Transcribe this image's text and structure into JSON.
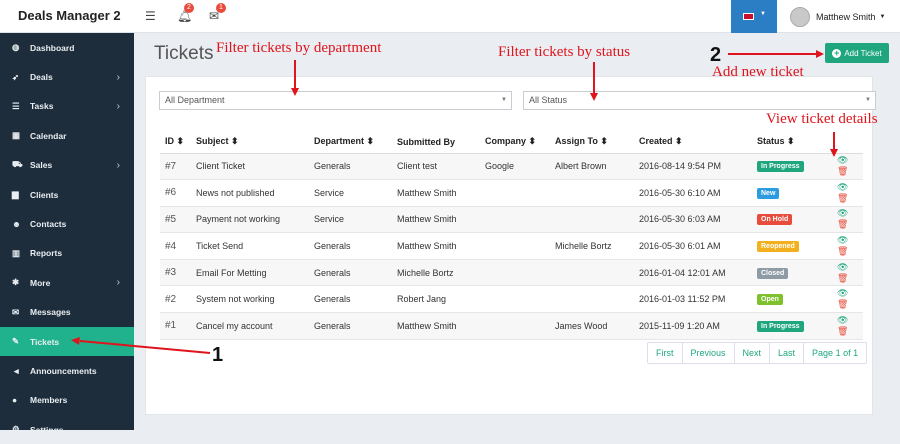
{
  "app": {
    "title": "Deals Manager 2"
  },
  "topbar": {
    "notif_count": "2",
    "msg_count": "1",
    "user_name": "Matthew Smith"
  },
  "sidebar": {
    "items": [
      {
        "icon": "dashboard-icon",
        "glyph": "◍",
        "label": "Dashboard",
        "chev": ""
      },
      {
        "icon": "rocket-icon",
        "glyph": "➶",
        "label": "Deals",
        "chev": "›"
      },
      {
        "icon": "tasks-icon",
        "glyph": "☰",
        "label": "Tasks",
        "chev": "›"
      },
      {
        "icon": "calendar-icon",
        "glyph": "▦",
        "label": "Calendar",
        "chev": ""
      },
      {
        "icon": "cart-icon",
        "glyph": "⛟",
        "label": "Sales",
        "chev": "›"
      },
      {
        "icon": "clients-icon",
        "glyph": "▆",
        "label": "Clients",
        "chev": ""
      },
      {
        "icon": "contacts-icon",
        "glyph": "☻",
        "label": "Contacts",
        "chev": ""
      },
      {
        "icon": "reports-icon",
        "glyph": "▥",
        "label": "Reports",
        "chev": ""
      },
      {
        "icon": "gear-icon",
        "glyph": "✱",
        "label": "More",
        "chev": "›"
      },
      {
        "icon": "messages-icon",
        "glyph": "✉",
        "label": "Messages",
        "chev": ""
      },
      {
        "icon": "ticket-icon",
        "glyph": "✎",
        "label": "Tickets",
        "chev": ""
      },
      {
        "icon": "megaphone-icon",
        "glyph": "◄",
        "label": "Announcements",
        "chev": ""
      },
      {
        "icon": "members-icon",
        "glyph": "●",
        "label": "Members",
        "chev": ""
      },
      {
        "icon": "settings-icon",
        "glyph": "⚙",
        "label": "Settings",
        "chev": ""
      }
    ]
  },
  "page": {
    "title": "Tickets",
    "add_button": "Add Ticket"
  },
  "filters": {
    "department": "All Department",
    "status": "All Status"
  },
  "table": {
    "headers": [
      "ID ⬍",
      "Subject ⬍",
      "Department ⬍",
      "Submitted By",
      "Company ⬍",
      "Assign To ⬍",
      "Created ⬍",
      "Status ⬍",
      ""
    ],
    "rows": [
      {
        "id": "#7",
        "subject": "Client Ticket",
        "department": "Generals",
        "submitted_by": "Client test",
        "company": "Google",
        "assign_to": "Albert Brown",
        "created": "2016-08-14 9:54 PM",
        "status": "In Progress",
        "status_color": "#1fa67f"
      },
      {
        "id": "#6",
        "subject": "News not published",
        "department": "Service",
        "submitted_by": "Matthew Smith",
        "company": "",
        "assign_to": "",
        "created": "2016-05-30 6:10 AM",
        "status": "New",
        "status_color": "#2b9ce0"
      },
      {
        "id": "#5",
        "subject": "Payment not working",
        "department": "Service",
        "submitted_by": "Matthew Smith",
        "company": "",
        "assign_to": "",
        "created": "2016-05-30 6:03 AM",
        "status": "On Hold",
        "status_color": "#e74c3c"
      },
      {
        "id": "#4",
        "subject": "Ticket Send",
        "department": "Generals",
        "submitted_by": "Matthew Smith",
        "company": "",
        "assign_to": "Michelle Bortz",
        "created": "2016-05-30 6:01 AM",
        "status": "Reopened",
        "status_color": "#f2b01e"
      },
      {
        "id": "#3",
        "subject": "Email For Metting",
        "department": "Generals",
        "submitted_by": "Michelle Bortz",
        "company": "",
        "assign_to": "",
        "created": "2016-01-04 12:01 AM",
        "status": "Closed",
        "status_color": "#8e9aa4"
      },
      {
        "id": "#2",
        "subject": "System not working",
        "department": "Generals",
        "submitted_by": "Robert Jang",
        "company": "",
        "assign_to": "",
        "created": "2016-01-03 11:52 PM",
        "status": "Open",
        "status_color": "#7fc12d"
      },
      {
        "id": "#1",
        "subject": "Cancel my account",
        "department": "Generals",
        "submitted_by": "Matthew Smith",
        "company": "",
        "assign_to": "James Wood",
        "created": "2015-11-09 1:20 AM",
        "status": "In Progress",
        "status_color": "#1fa67f"
      }
    ]
  },
  "pagination": {
    "first": "First",
    "previous": "Previous",
    "next": "Next",
    "last": "Last",
    "page": "Page 1 of 1"
  },
  "annotations": {
    "filter_department": "Filter tickets by department",
    "filter_status": "Filter tickets by status",
    "add_ticket": "Add new ticket",
    "view_details": "View ticket details",
    "num1": "1",
    "num2": "2"
  },
  "colors": {
    "accent": "#1fa67f",
    "sidebar": "#1e2d3b",
    "annotation": "#e0141c"
  }
}
